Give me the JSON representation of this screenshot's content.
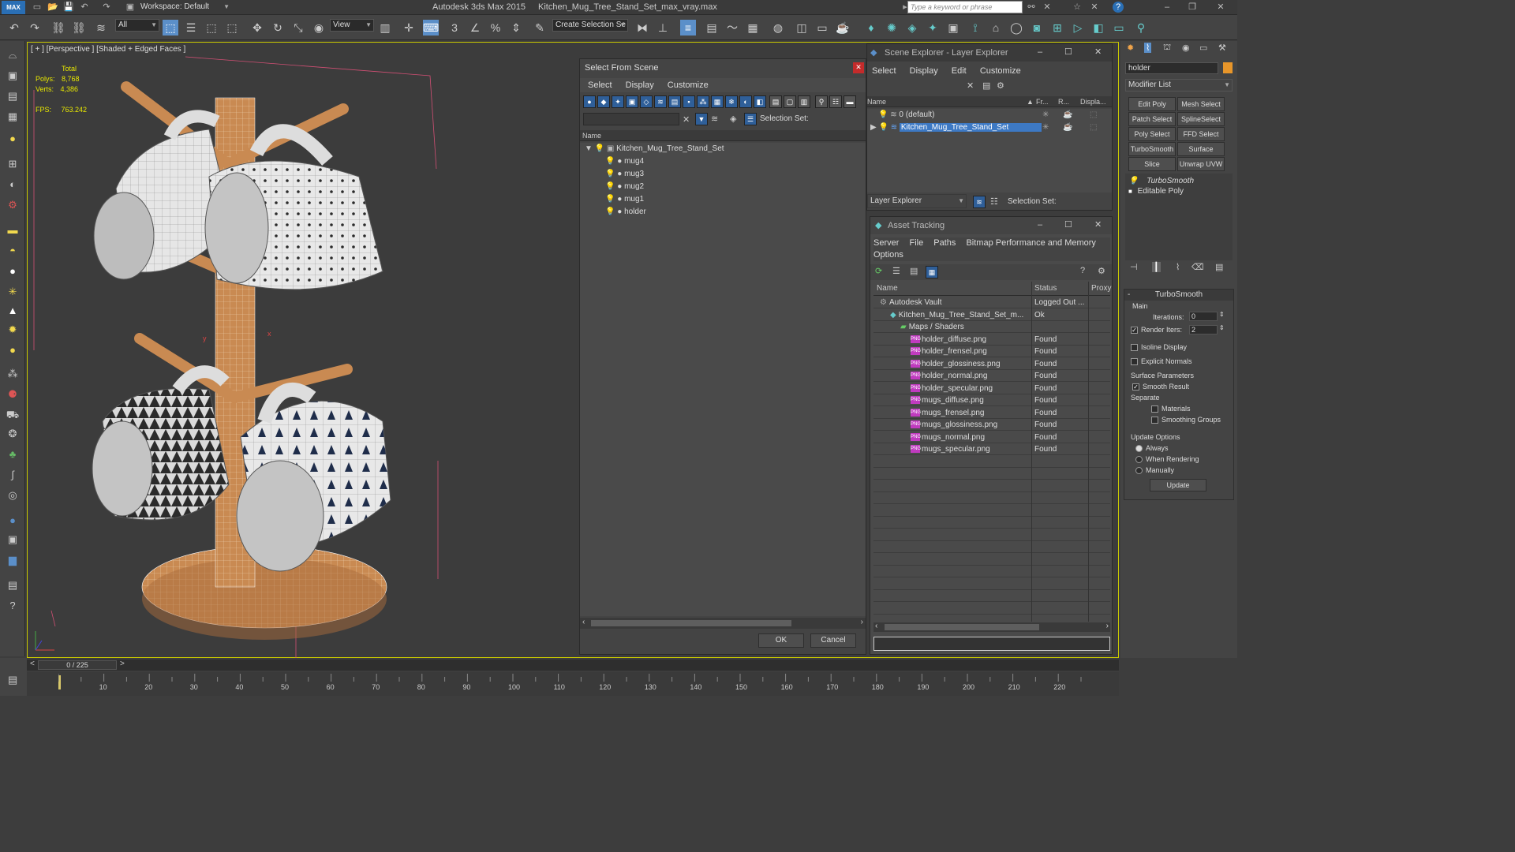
{
  "window": {
    "workspace_label": "Workspace: Default",
    "app_title": "Autodesk 3ds Max  2015",
    "file_name": "Kitchen_Mug_Tree_Stand_Set_max_vray.max",
    "search_placeholder": "Type a keyword or phrase"
  },
  "toolbar": {
    "filter_value": "All",
    "refcoord_value": "View",
    "selection_set_placeholder": "Create Selection Se"
  },
  "viewport": {
    "label": "[ + ] [Perspective ] [Shaded + Edged Faces ]",
    "stats": {
      "total_label": "Total",
      "polys_label": "Polys:",
      "polys_value": "8,768",
      "verts_label": "Verts:",
      "verts_value": "4,386",
      "fps_label": "FPS:",
      "fps_value": "763.242"
    },
    "axis_x": "x",
    "axis_y": "y"
  },
  "select_from_scene": {
    "title": "Select From Scene",
    "menu": [
      "Select",
      "Display",
      "Customize"
    ],
    "selection_set_label": "Selection Set:",
    "column_name": "Name",
    "tree": [
      {
        "label": "Kitchen_Mug_Tree_Stand_Set",
        "level": 0
      },
      {
        "label": "mug4",
        "level": 1
      },
      {
        "label": "mug3",
        "level": 1
      },
      {
        "label": "mug2",
        "level": 1
      },
      {
        "label": "mug1",
        "level": 1
      },
      {
        "label": "holder",
        "level": 1
      }
    ],
    "ok_label": "OK",
    "cancel_label": "Cancel"
  },
  "scene_explorer": {
    "title": "Scene Explorer - Layer Explorer",
    "menu": [
      "Select",
      "Display",
      "Edit",
      "Customize"
    ],
    "columns": [
      "Name",
      "Fr...",
      "R...",
      "Displa..."
    ],
    "rows": [
      {
        "label": "0 (default)",
        "selected": false
      },
      {
        "label": "Kitchen_Mug_Tree_Stand_Set",
        "selected": true
      }
    ],
    "footer_combo": "Layer Explorer",
    "selection_set_label": "Selection Set:"
  },
  "asset_tracking": {
    "title": "Asset Tracking",
    "menu": [
      "Server",
      "File",
      "Paths",
      "Bitmap Performance and Memory",
      "Options"
    ],
    "columns": [
      "Name",
      "Status",
      "Proxy"
    ],
    "rows": [
      {
        "name": "Autodesk Vault",
        "status": "Logged Out ...",
        "indent": 0,
        "kind": "vault"
      },
      {
        "name": "Kitchen_Mug_Tree_Stand_Set_m...",
        "status": "Ok",
        "indent": 1,
        "kind": "max"
      },
      {
        "name": "Maps / Shaders",
        "status": "",
        "indent": 2,
        "kind": "folder"
      },
      {
        "name": "holder_diffuse.png",
        "status": "Found",
        "indent": 3,
        "kind": "png"
      },
      {
        "name": "holder_frensel.png",
        "status": "Found",
        "indent": 3,
        "kind": "png"
      },
      {
        "name": "holder_glossiness.png",
        "status": "Found",
        "indent": 3,
        "kind": "png"
      },
      {
        "name": "holder_normal.png",
        "status": "Found",
        "indent": 3,
        "kind": "png"
      },
      {
        "name": "holder_specular.png",
        "status": "Found",
        "indent": 3,
        "kind": "png"
      },
      {
        "name": "mugs_diffuse.png",
        "status": "Found",
        "indent": 3,
        "kind": "png"
      },
      {
        "name": "mugs_frensel.png",
        "status": "Found",
        "indent": 3,
        "kind": "png"
      },
      {
        "name": "mugs_glossiness.png",
        "status": "Found",
        "indent": 3,
        "kind": "png"
      },
      {
        "name": "mugs_normal.png",
        "status": "Found",
        "indent": 3,
        "kind": "png"
      },
      {
        "name": "mugs_specular.png",
        "status": "Found",
        "indent": 3,
        "kind": "png"
      }
    ],
    "png_badge": "PNG"
  },
  "command_panel": {
    "object_name": "holder",
    "modifier_list_label": "Modifier List",
    "buttons": [
      "Edit Poly",
      "Mesh Select",
      "Patch Select",
      "SplineSelect",
      "Poly Select",
      "FFD Select",
      "TurboSmooth",
      "Surface Select",
      "Slice",
      "Unwrap UVW"
    ],
    "stack": [
      "TurboSmooth",
      "Editable Poly"
    ],
    "rollout_title": "TurboSmooth",
    "main_label": "Main",
    "iterations_label": "Iterations:",
    "iterations_value": "0",
    "render_iters_label": "Render Iters:",
    "render_iters_value": "2",
    "isoline_label": "Isoline Display",
    "explicit_normals_label": "Explicit Normals",
    "surface_params_label": "Surface Parameters",
    "smooth_result_label": "Smooth Result",
    "separate_label": "Separate",
    "materials_label": "Materials",
    "smoothing_groups_label": "Smoothing Groups",
    "update_options_label": "Update Options",
    "always_label": "Always",
    "when_rendering_label": "When Rendering",
    "manually_label": "Manually",
    "update_button": "Update"
  },
  "timeline": {
    "frame_label": "0 / 225",
    "prev": "<",
    "next": ">",
    "ticks": [
      "10",
      "20",
      "30",
      "40",
      "50",
      "60",
      "70",
      "80",
      "90",
      "100",
      "110",
      "120",
      "130",
      "140",
      "150",
      "160",
      "170",
      "180",
      "190",
      "200",
      "210",
      "220"
    ]
  }
}
